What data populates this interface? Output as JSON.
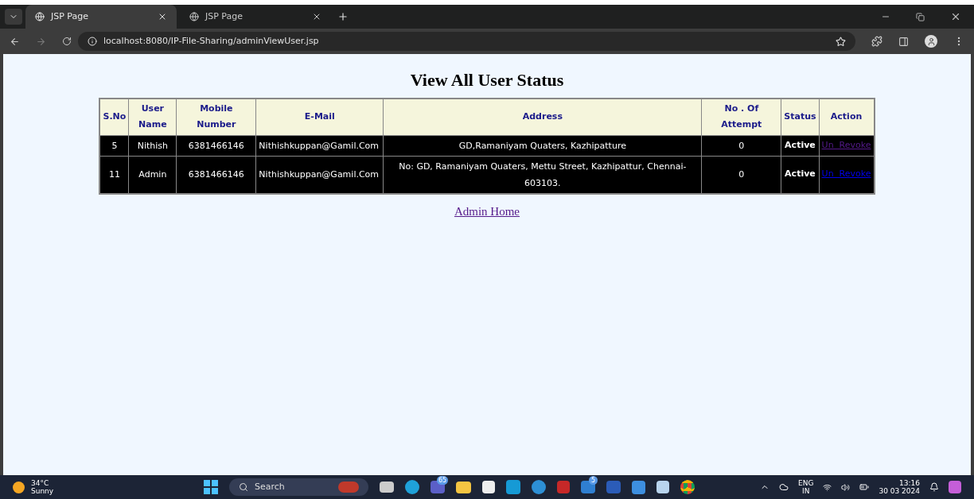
{
  "tabs": [
    {
      "title": "JSP Page",
      "selected": true
    },
    {
      "title": "JSP Page",
      "selected": false
    }
  ],
  "address_bar": {
    "url": "localhost:8080/IP-File-Sharing/adminViewUser.jsp"
  },
  "page": {
    "heading": "View All User Status",
    "table": {
      "columns": [
        "S.No",
        "User Name",
        "Mobile Number",
        "E-Mail",
        "Address",
        "No . Of Attempt",
        "Status",
        "Action"
      ],
      "rows": [
        {
          "sno": "5",
          "user_name": "Nithish",
          "mobile": "6381466146",
          "email": "Nithishkuppan@Gamil.Com",
          "address": "GD,Ramaniyam Quaters, Kazhipatture",
          "attempts": "0",
          "status": "Active",
          "action": "Un  Revoke",
          "visited": true
        },
        {
          "sno": "11",
          "user_name": "Admin",
          "mobile": "6381466146",
          "email": "Nithishkuppan@Gamil.Com",
          "address": "No: GD, Ramaniyam Quaters, Mettu Street, Kazhipattur, Chennai-603103.",
          "attempts": "0",
          "status": "Active",
          "action": "Un  Revoke",
          "visited": false
        }
      ]
    },
    "home_link": "Admin Home"
  },
  "taskbar": {
    "weather": {
      "temperature": "34°C",
      "condition": "Sunny"
    },
    "search_placeholder": "Search",
    "badges": [
      "65",
      "5"
    ],
    "language": {
      "top": "ENG",
      "bottom": "IN"
    },
    "time": "13:16",
    "date": "30 03 2024"
  }
}
